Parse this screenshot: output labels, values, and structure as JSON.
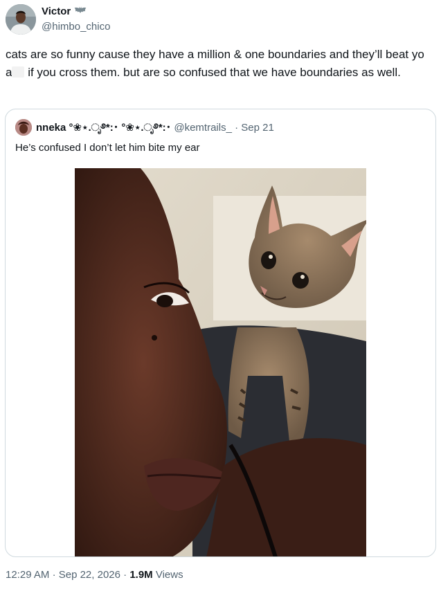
{
  "author": {
    "name": "Victor",
    "handle": "@himbo_chico",
    "name_emoji_icon": "bat-emoji-icon"
  },
  "tweet": {
    "text_part1": "cats are so funny cause they have a million & one boundaries and they’ll beat yo a",
    "text_part2": " if you cross them. but are so confused that we have boundaries as well."
  },
  "quote": {
    "name": "nneka °❀⋆.ೃ࿔*:･ °❀⋆.ೃ࿔*:･",
    "handle": "@kemtrails_",
    "separator": "·",
    "date": "Sep 21",
    "text": "He’s confused I don’t let him bite my ear"
  },
  "meta": {
    "time": "12:29 AM",
    "separator": "·",
    "date": "Sep 22, 2026",
    "views_count": "1.9M",
    "views_label": "Views"
  },
  "colors": {
    "text_primary": "#0f1419",
    "text_secondary": "#536471",
    "border": "#cfd9de",
    "background": "#ffffff"
  }
}
